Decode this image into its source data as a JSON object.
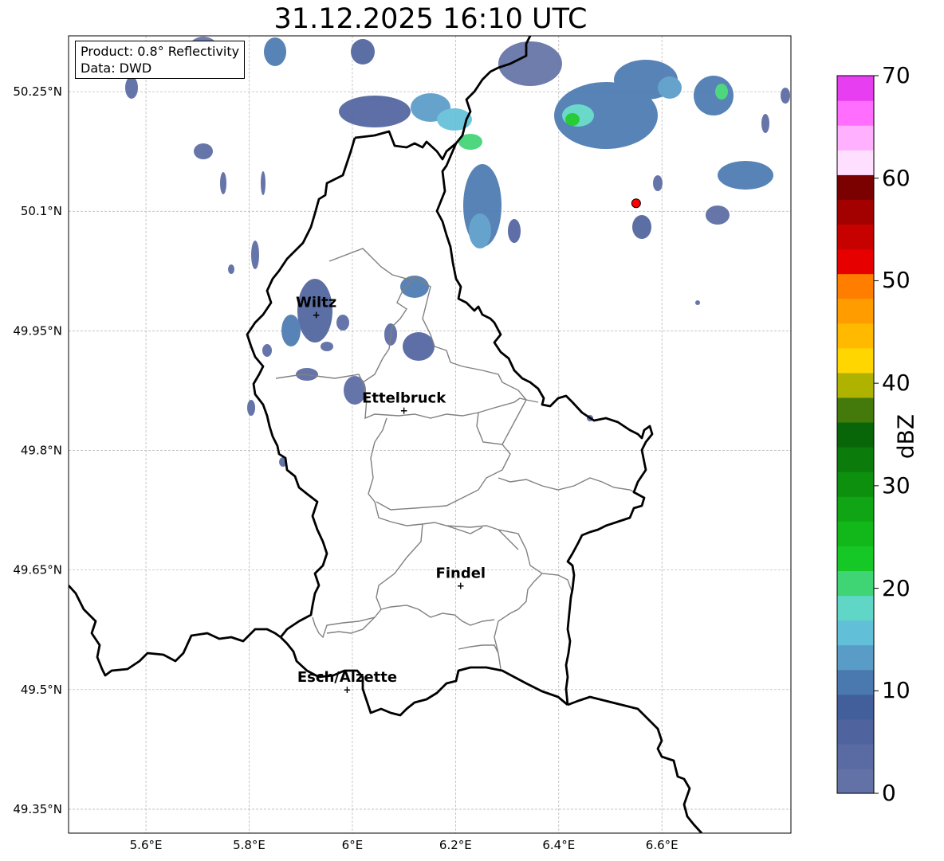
{
  "title": "31.12.2025 16:10 UTC",
  "info_box": {
    "product": "Product: 0.8° Reflectivity",
    "source": "Data: DWD"
  },
  "map_extent": {
    "lon": [
      5.45,
      6.85
    ],
    "lat": [
      49.32,
      50.32
    ]
  },
  "lat_ticks": [
    "50.25°N",
    "50.1°N",
    "49.95°N",
    "49.8°N",
    "49.65°N",
    "49.5°N",
    "49.35°N"
  ],
  "lon_ticks": [
    "5.6°E",
    "5.8°E",
    "6°E",
    "6.2°E",
    "6.4°E",
    "6.6°E"
  ],
  "cities": [
    {
      "name": "Wiltz",
      "lon": 5.93,
      "lat": 49.97
    },
    {
      "name": "Ettelbruck",
      "lon": 6.1,
      "lat": 49.85
    },
    {
      "name": "Findel",
      "lon": 6.21,
      "lat": 49.63
    },
    {
      "name": "Esch/Alzette",
      "lon": 5.99,
      "lat": 49.5
    }
  ],
  "radar_site": {
    "lon": 6.55,
    "lat": 50.11,
    "color": "#ff0000"
  },
  "colorbar": {
    "label": "dBZ",
    "min": 0,
    "max": 70,
    "ticks": [
      "0",
      "10",
      "20",
      "30",
      "40",
      "50",
      "60",
      "70"
    ],
    "colors": [
      "#6272a6",
      "#5a6aa2",
      "#4f639e",
      "#425f9c",
      "#4a79b0",
      "#5a9cc8",
      "#62bfd8",
      "#5fd6c6",
      "#3fd474",
      "#15c826",
      "#12b81a",
      "#10a514",
      "#0e900f",
      "#0b7b0b",
      "#086608",
      "#447a0c",
      "#afb300",
      "#ffd600",
      "#ffba00",
      "#ff9c00",
      "#ff7e00",
      "#e60000",
      "#c70000",
      "#a30000",
      "#7b0000",
      "#ffdfff",
      "#ffb1ff",
      "#ff6efe",
      "#e73ef2"
    ]
  }
}
